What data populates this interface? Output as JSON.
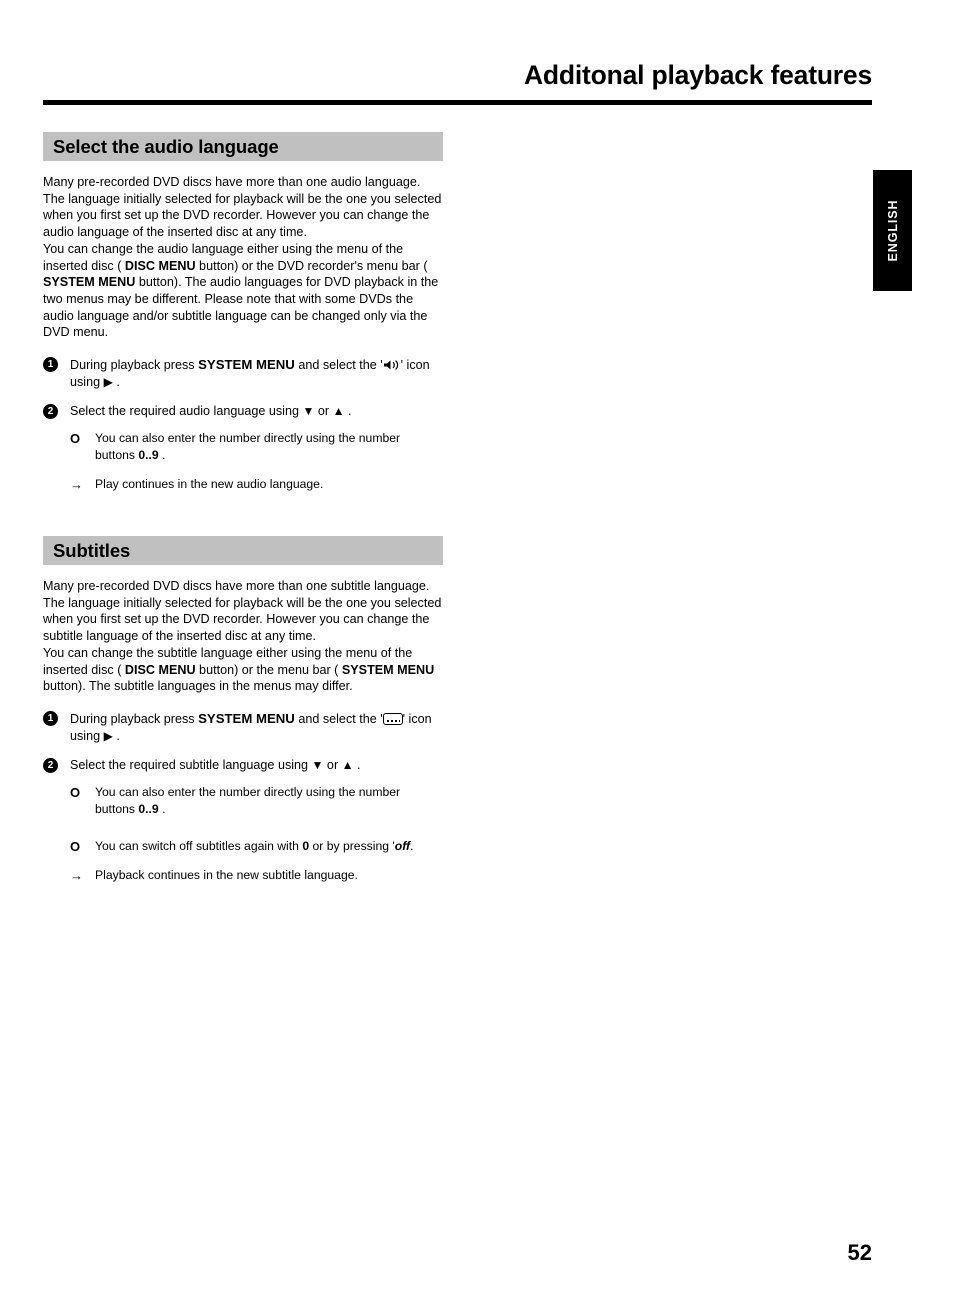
{
  "header": {
    "title": "Additonal playback features"
  },
  "language_tab": {
    "label": "ENGLISH"
  },
  "page_footer": {
    "page_number": "52"
  },
  "colors": {
    "section_bar_gray": "#c0c0c0",
    "rule_black": "#000000",
    "tab_black": "#000000",
    "tab_text_white": "#ffffff"
  },
  "sections": [
    {
      "id": "select-the-audio-language",
      "heading": "Select the audio language",
      "paragraph_1": "Many pre-recorded DVD discs have more than one audio language. The language initially selected for playback will be the one you selected when you first set up the DVD recorder. However you can change the audio language of the inserted disc at any time.",
      "paragraph_2_a": "You can change the audio language either using the menu of the inserted disc ( ",
      "paragraph_2_b1": "DISC MENU",
      "paragraph_2_c": " button) or the DVD recorder's menu bar ( ",
      "paragraph_2_b2": "SYSTEM MENU",
      "paragraph_2_d": " button). The audio languages for DVD playback in the two menus may be different. Please note that with some DVDs the audio language and/or subtitle language can be changed only via the DVD menu.",
      "step1": {
        "number": "1",
        "text_a": "During playback press ",
        "bold": "SYSTEM MENU",
        "text_b": " and select the '",
        "icon": "audio-speaker-icon",
        "text_c": "' icon using ",
        "arrow": "▶",
        "text_d": " ."
      },
      "step2": {
        "number": "2",
        "text_a": "Select the required audio language using ",
        "down_arrow": "▼",
        "text_b": " or ",
        "up_arrow": "▲",
        "text_c": " ."
      },
      "bullets": [
        {
          "marker": "O",
          "text_a": "You can also enter the number directly using the number buttons ",
          "bold": "0..9",
          "text_b": " ."
        }
      ],
      "result": {
        "marker": "→",
        "text": "Play continues in the new audio language."
      }
    },
    {
      "id": "subtitles",
      "heading": "Subtitles",
      "paragraph_1": "Many pre-recorded DVD discs have more than one subtitle language. The language initially selected for playback will be the one you selected when you first set up the DVD recorder. However you can change the subtitle language of the inserted disc at any time.",
      "paragraph_2_a": "You can change the subtitle language either using the menu of the inserted disc ( ",
      "paragraph_2_b1": "DISC MENU",
      "paragraph_2_c": " button) or the menu bar ( ",
      "paragraph_2_b2": "SYSTEM MENU",
      "paragraph_2_d": " button). The subtitle languages in the menus may differ.",
      "step1": {
        "number": "1",
        "text_a": "During playback press ",
        "bold": "SYSTEM MENU",
        "text_b": " and select the '",
        "icon": "subtitle-box-icon",
        "text_c": "' icon using ",
        "arrow": "▶",
        "text_d": " ."
      },
      "step2": {
        "number": "2",
        "text_a": "Select the required subtitle language using ",
        "down_arrow": "▼",
        "text_b": " or ",
        "up_arrow": "▲",
        "text_c": " ."
      },
      "bullets": [
        {
          "marker": "O",
          "text_a": "You can also enter the number directly using the number buttons ",
          "bold": "0..9",
          "text_b": " ."
        },
        {
          "marker": "O",
          "text_a": "You can switch off subtitles again with ",
          "bold": "0",
          "text_b": " or by pressing '",
          "bold_italic": "off",
          "text_c": "."
        }
      ],
      "result": {
        "marker": "→",
        "text": "Playback continues in the new subtitle language."
      }
    }
  ]
}
